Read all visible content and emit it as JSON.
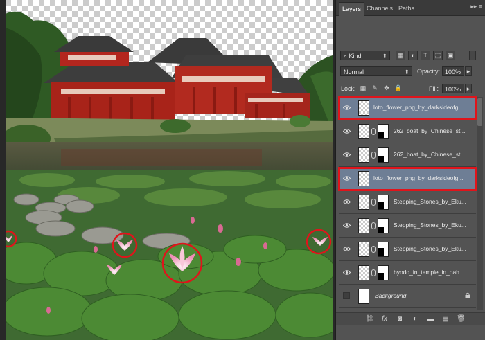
{
  "panel": {
    "tabs": [
      "Layers",
      "Channels",
      "Paths"
    ],
    "active_tab": "Layers",
    "filter_kind": "Kind",
    "blend_mode": "Normal",
    "opacity_label": "Opacity:",
    "opacity_value": "100%",
    "lock_label": "Lock:",
    "fill_label": "Fill:",
    "fill_value": "100%"
  },
  "layers": [
    {
      "name": "loto_flower_png_by_darksideofg...",
      "type": "pixel",
      "selected": true,
      "highlighted": true,
      "visible": true
    },
    {
      "name": "262_boat_by_Chinese_st...",
      "type": "masked",
      "selected": false,
      "highlighted": false,
      "visible": true
    },
    {
      "name": "262_boat_by_Chinese_st...",
      "type": "masked",
      "selected": false,
      "highlighted": false,
      "visible": true
    },
    {
      "name": "loto_flower_png_by_darksideofg...",
      "type": "pixel",
      "selected": true,
      "highlighted": true,
      "visible": true
    },
    {
      "name": "Stepping_Stones_by_Eku...",
      "type": "masked",
      "selected": false,
      "highlighted": false,
      "visible": true
    },
    {
      "name": "Stepping_Stones_by_Eku...",
      "type": "masked",
      "selected": false,
      "highlighted": false,
      "visible": true
    },
    {
      "name": "Stepping_Stones_by_Eku...",
      "type": "masked",
      "selected": false,
      "highlighted": false,
      "visible": true
    },
    {
      "name": "byodo_in_temple_in_oah...",
      "type": "masked",
      "selected": false,
      "highlighted": false,
      "visible": true
    },
    {
      "name": "Background",
      "type": "background",
      "selected": false,
      "highlighted": false,
      "visible": false
    }
  ],
  "colors": {
    "panel_bg": "#535353",
    "selected_layer": "#6e7e95",
    "highlight_red": "#e0141b",
    "temple_red": "#b3261e",
    "lotus_pink": "#f2a6c2"
  },
  "icons": [
    "eye-icon",
    "lock-icon",
    "link-icon",
    "fx-icon",
    "mask-icon",
    "adjustment-icon",
    "folder-icon",
    "new-layer-icon",
    "trash-icon"
  ]
}
